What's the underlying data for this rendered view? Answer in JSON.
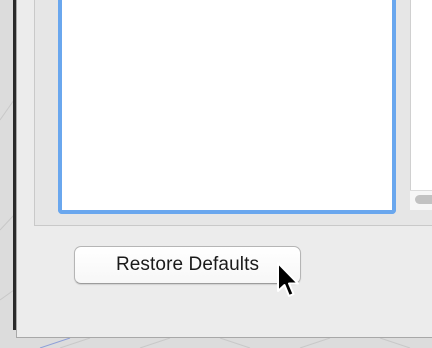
{
  "restore_button": {
    "label": "Restore Defaults"
  },
  "colors": {
    "focus_ring": "#6aa7ee",
    "window_bg": "#ececec",
    "list_bg": "#ffffff"
  },
  "icons": {
    "cursor": "arrow-pointer-icon"
  }
}
